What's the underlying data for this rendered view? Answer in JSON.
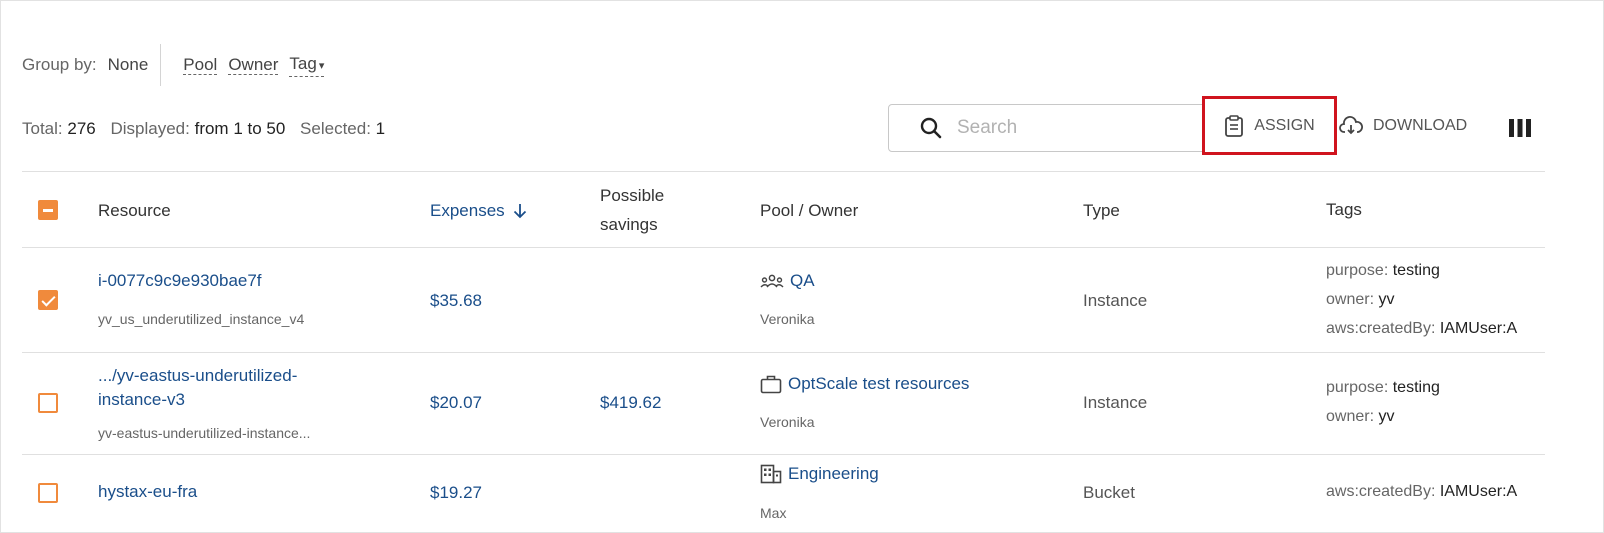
{
  "group_by": {
    "label": "Group by:",
    "value": "None",
    "options": [
      "Pool",
      "Owner",
      "Tag"
    ]
  },
  "totals": {
    "total_label": "Total:",
    "total_value": "276",
    "displayed_label": "Displayed:",
    "displayed_value": "from 1 to 50",
    "selected_label": "Selected:",
    "selected_value": "1"
  },
  "toolbar": {
    "search_placeholder": "Search",
    "assign_label": "ASSIGN",
    "download_label": "DOWNLOAD"
  },
  "table": {
    "columns": {
      "resource": "Resource",
      "expenses": "Expenses",
      "savings_line1": "Possible",
      "savings_line2": "savings",
      "pool_owner": "Pool / Owner",
      "type": "Type",
      "tags": "Tags"
    },
    "header_checkbox_state": "partial",
    "rows": [
      {
        "checked": true,
        "resource_line1": "i-0077c9c9e930bae7f",
        "resource_line2": "",
        "resource_sub": "yv_us_underutilized_instance_v4",
        "expenses": "$35.68",
        "savings": "",
        "pool_icon": "group-icon",
        "pool": "QA",
        "owner": "Veronika",
        "type": "Instance",
        "tags": [
          {
            "key": "purpose:",
            "value": "testing"
          },
          {
            "key": "owner:",
            "value": "yv"
          },
          {
            "key": "aws:createdBy:",
            "value": "IAMUser:A"
          }
        ]
      },
      {
        "checked": false,
        "resource_line1": ".../yv-eastus-underutilized-",
        "resource_line2": "instance-v3",
        "resource_sub": "yv-eastus-underutilized-instance...",
        "expenses": "$20.07",
        "savings": "$419.62",
        "pool_icon": "briefcase-icon",
        "pool": "OptScale test resources",
        "owner": "Veronika",
        "type": "Instance",
        "tags": [
          {
            "key": "purpose:",
            "value": "testing"
          },
          {
            "key": "owner:",
            "value": "yv"
          }
        ]
      },
      {
        "checked": false,
        "resource_line1": "hystax-eu-fra",
        "resource_line2": "",
        "resource_sub": "",
        "expenses": "$19.27",
        "savings": "",
        "pool_icon": "building-icon",
        "pool": "Engineering",
        "owner": "Max",
        "type": "Bucket",
        "tags": [
          {
            "key": "aws:createdBy:",
            "value": "IAMUser:A"
          }
        ]
      }
    ]
  }
}
